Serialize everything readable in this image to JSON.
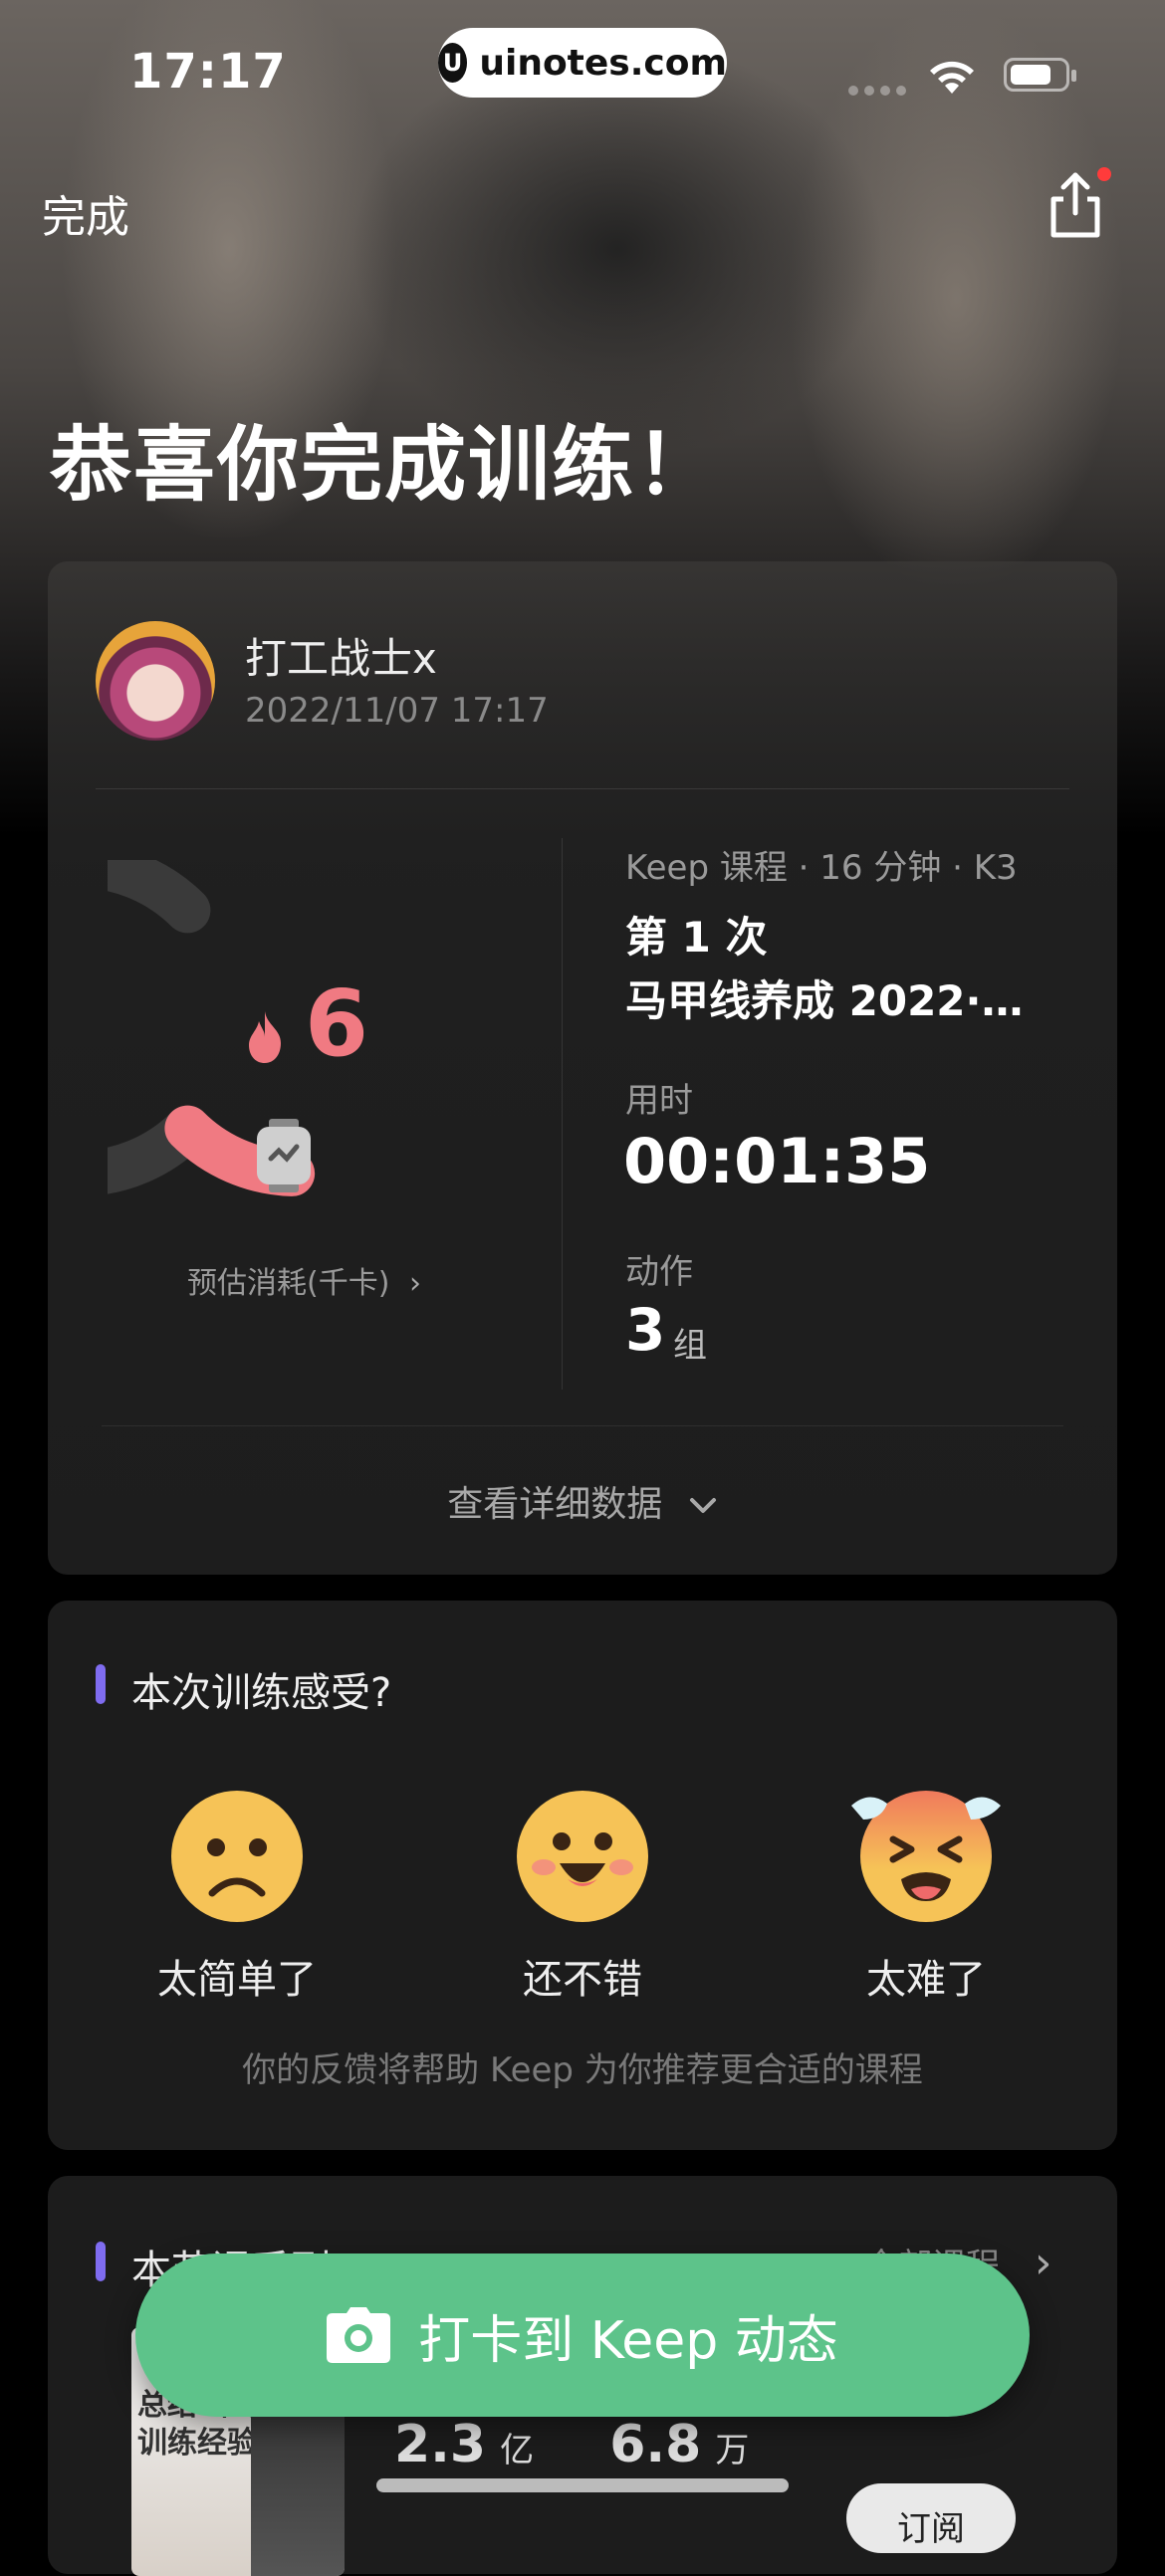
{
  "status_bar": {
    "time": "17:17",
    "url": "uinotes.com"
  },
  "header": {
    "done_label": "完成",
    "congrats": "恭喜你完成训练！"
  },
  "summary": {
    "username": "打工战士x",
    "datetime": "2022/11/07 17:17",
    "calories": "6",
    "calories_label": "预估消耗(千卡)",
    "calories_fill_fraction": 0.16,
    "course_meta": "Keep 课程 · 16 分钟 · K3",
    "session": "第 1 次",
    "course_name": "马甲线养成 2022·经...",
    "duration_label": "用时",
    "duration_value": "00:01:35",
    "actions_label": "动作",
    "actions_value": "3",
    "actions_unit": "组",
    "details_label": "查看详细数据",
    "accent_color": "#f07a82"
  },
  "feedback": {
    "title": "本次训练感受?",
    "options": [
      {
        "label": "太简单了",
        "icon": "sad-face-icon"
      },
      {
        "label": "还不错",
        "icon": "happy-face-icon"
      },
      {
        "label": "太难了",
        "icon": "sweating-face-icon"
      }
    ],
    "hint": "你的反馈将帮助 Keep 为你推荐更合适的课程"
  },
  "series": {
    "title": "本节课系列",
    "all_label": "全部课程",
    "thumb_text_1": "总结2亿人",
    "thumb_text_2": "训练经验",
    "stat_1": "2.3",
    "stat_1_unit": "亿",
    "stat_2": "6.8",
    "stat_2_unit": "万",
    "subscribe_label": "订阅"
  },
  "checkin": {
    "label": "打卡到 Keep 动态",
    "color": "#5dc38a"
  }
}
